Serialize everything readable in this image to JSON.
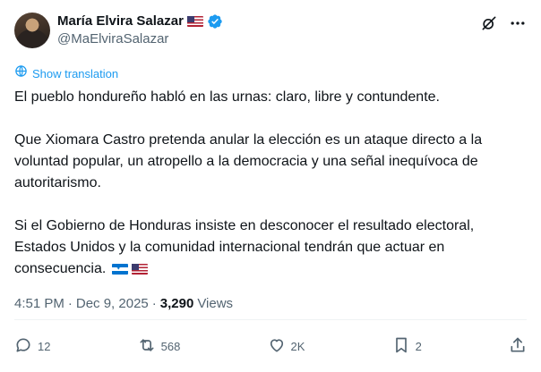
{
  "author": {
    "name": "María Elvira Salazar",
    "handle": "@MaElviraSalazar"
  },
  "translate": {
    "label": "Show translation"
  },
  "body": {
    "p1": "El pueblo hondureño habló en las urnas: claro, libre y contundente.",
    "p2": "Que Xiomara Castro pretenda anular la elección es un ataque directo a la voluntad popular, un atropello a la democracia y una señal inequívoca de autoritarismo.",
    "p3": "Si el Gobierno de Honduras insiste en desconocer el resultado electoral, Estados Unidos y la comunidad internacional tendrán que actuar en consecuencia."
  },
  "meta": {
    "time": "4:51 PM",
    "separator": "·",
    "date": "Dec 9, 2025",
    "views_count": "3,290",
    "views_label": "Views"
  },
  "actions": {
    "replies": "12",
    "reposts": "568",
    "likes": "2K",
    "bookmarks": "2"
  },
  "icons": {
    "verified": "verified-badge-icon",
    "grok": "grok-icon",
    "more": "more-icon",
    "globe": "globe-icon",
    "reply": "reply-icon",
    "repost": "repost-icon",
    "like": "like-icon",
    "bookmark": "bookmark-icon",
    "share": "share-icon"
  },
  "colors": {
    "accent": "#1d9bf0",
    "text": "#0f1419",
    "secondary": "#536471"
  }
}
